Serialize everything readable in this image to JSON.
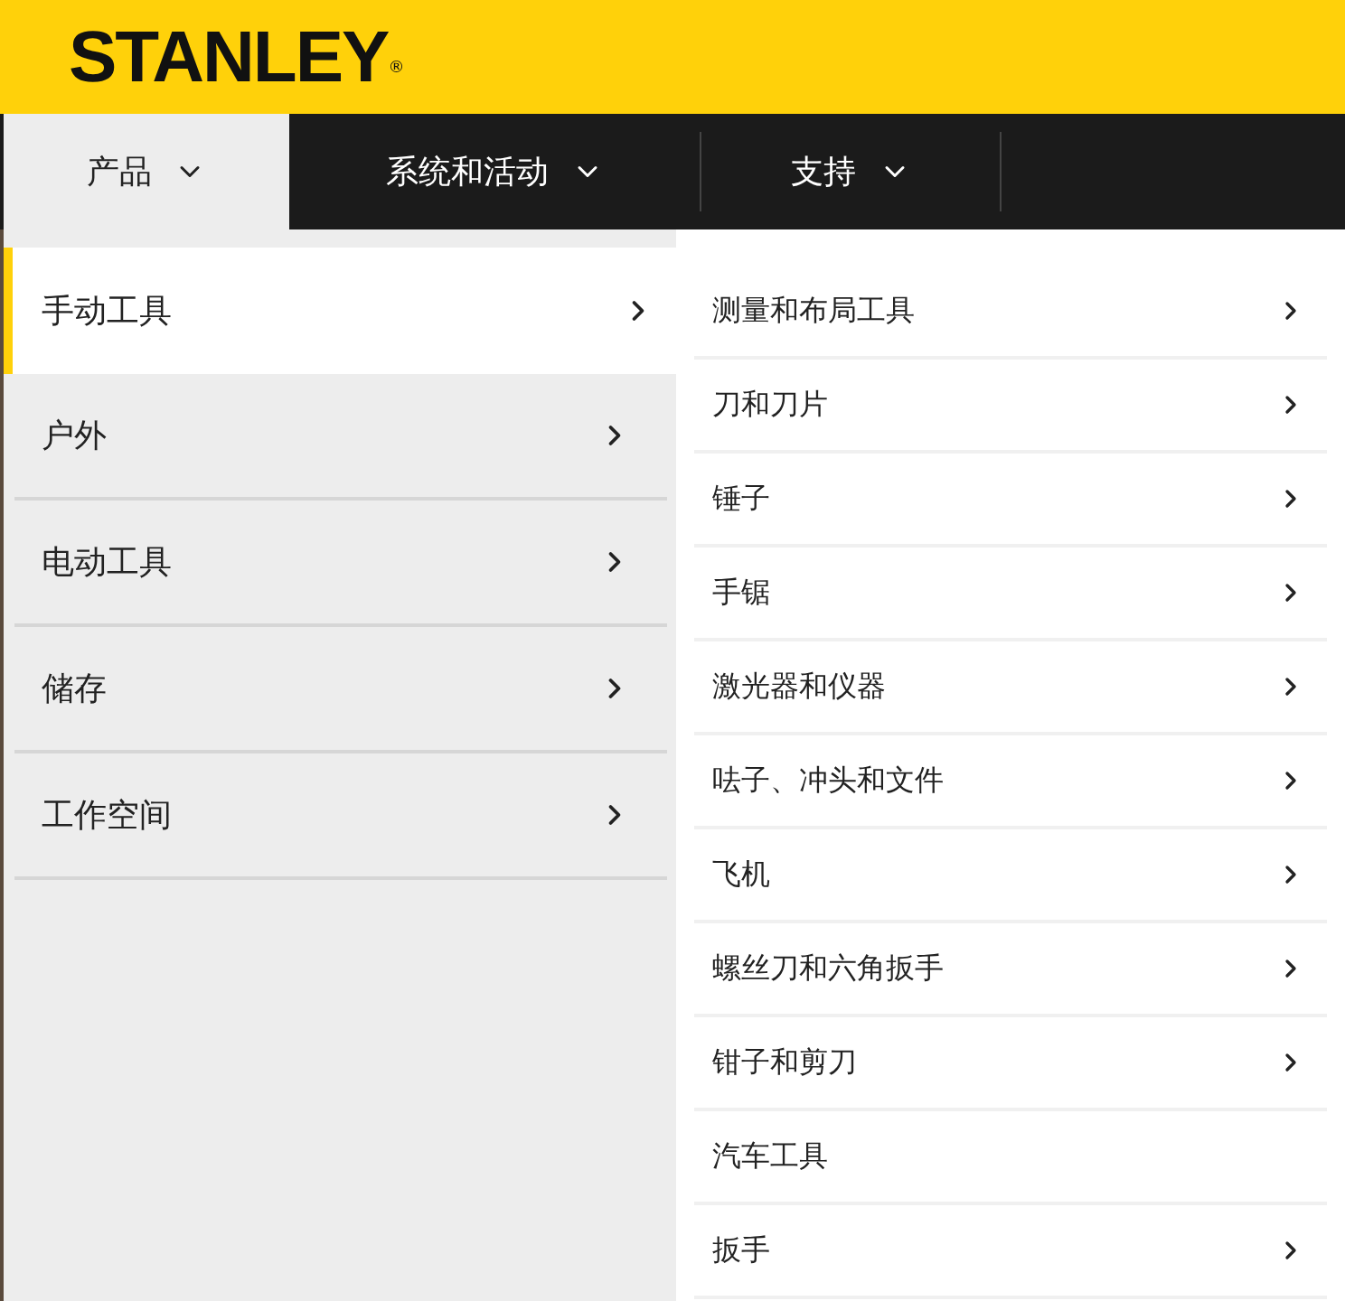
{
  "logo": {
    "text": "STANLEY",
    "mark": "®"
  },
  "nav": [
    {
      "label": "产品",
      "selected": true
    },
    {
      "label": "系统和活动",
      "selected": false
    },
    {
      "label": "支持",
      "selected": false
    }
  ],
  "categories": [
    {
      "label": "手动工具",
      "selected": true
    },
    {
      "label": "户外",
      "selected": false
    },
    {
      "label": "电动工具",
      "selected": false
    },
    {
      "label": "储存",
      "selected": false
    },
    {
      "label": "工作空间",
      "selected": false
    }
  ],
  "subcategories": [
    {
      "label": "测量和布局工具",
      "has_children": true
    },
    {
      "label": "刀和刀片",
      "has_children": true
    },
    {
      "label": "锤子",
      "has_children": true
    },
    {
      "label": "手锯",
      "has_children": true
    },
    {
      "label": "激光器和仪器",
      "has_children": true
    },
    {
      "label": "呿子、冲头和文件",
      "has_children": true
    },
    {
      "label": "飞机",
      "has_children": true
    },
    {
      "label": "螺丝刀和六角扳手",
      "has_children": true
    },
    {
      "label": "钳子和剪刀",
      "has_children": true
    },
    {
      "label": "汽车工具",
      "has_children": false
    },
    {
      "label": "扳手",
      "has_children": true
    }
  ]
}
